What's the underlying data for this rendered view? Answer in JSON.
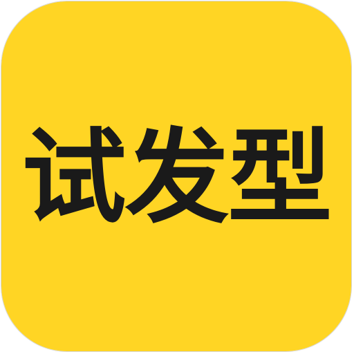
{
  "app_icon": {
    "name": "试发型",
    "background_color": "#FFD524",
    "text_color": "#1A1A1A"
  }
}
